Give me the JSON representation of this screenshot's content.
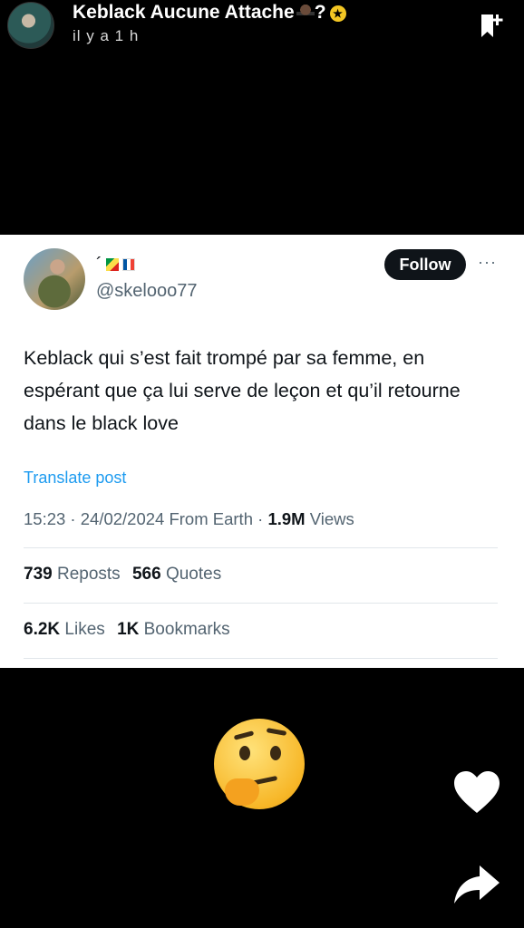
{
  "header": {
    "uploader_name": "Keblack Aucune Attache",
    "name_suffix": "?",
    "time_ago": "il y a 1 h"
  },
  "tweet": {
    "display_name_prefix": "´",
    "handle": "@skelooo77",
    "follow_label": "Follow",
    "more": "···",
    "text": "Keblack qui s’est fait trompé par sa femme, en espérant que ça lui serve de leçon et qu’il retourne dans le black love",
    "translate_label": "Translate post",
    "time": "15:23 · 24/02/2024 From Earth · ",
    "views_count": "1.9M",
    "views_label": " Views",
    "reposts_count": "739",
    "reposts_label": " Reposts",
    "quotes_count": "566",
    "quotes_label": " Quotes",
    "likes_count": "6.2K",
    "likes_label": " Likes",
    "bookmarks_count": "1K",
    "bookmarks_label": " Bookmarks"
  },
  "icons": {
    "bookmark": "bookmark-add-icon",
    "reaction": "thinking-face-emoji",
    "like": "heart-icon",
    "share": "share-icon"
  },
  "colors": {
    "accent_link": "#1d9bf0",
    "follow_button": "#0f1419",
    "muted_text": "#536471",
    "background": "#000000",
    "card": "#ffffff"
  }
}
